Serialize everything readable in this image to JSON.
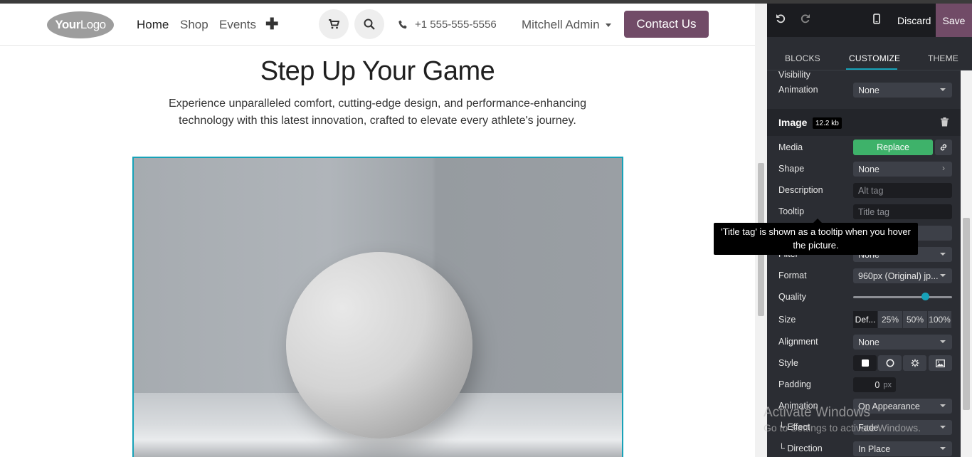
{
  "navbar": {
    "logo": {
      "bold": "Your",
      "thin": "Logo"
    },
    "links": [
      "Home",
      "Shop",
      "Events"
    ],
    "plus": "✚",
    "phone": "+1 555-555-5556",
    "user": "Mitchell Admin",
    "contact_label": "Contact Us"
  },
  "hero": {
    "title": "Step Up Your Game",
    "subtitle": "Experience unparalleled comfort, cutting-edge design, and performance-enhancing technology with this latest innovation, crafted to elevate every athlete's journey."
  },
  "editor": {
    "discard_label": "Discard",
    "save_label": "Save",
    "tabs": [
      "BLOCKS",
      "CUSTOMIZE",
      "THEME"
    ],
    "active_tab": "CUSTOMIZE",
    "visibility_label": "Visibility",
    "animation_top": {
      "label": "Animation",
      "value": "None"
    },
    "image_section": {
      "title": "Image",
      "size_badge": "12.2 kb"
    },
    "media": {
      "label": "Media",
      "replace_label": "Replace"
    },
    "shape": {
      "label": "Shape",
      "value": "None"
    },
    "description": {
      "label": "Description",
      "placeholder": "Alt tag"
    },
    "tooltip_row": {
      "label": "Tooltip",
      "placeholder": "Title tag"
    },
    "filter": {
      "label": "Filter",
      "value": "None"
    },
    "format": {
      "label": "Format",
      "value": "960px (Original) jp..."
    },
    "quality": {
      "label": "Quality",
      "value": 0.73
    },
    "size": {
      "label": "Size",
      "options": [
        "Def...",
        "25%",
        "50%",
        "100%"
      ],
      "selected": "Def..."
    },
    "alignment": {
      "label": "Alignment",
      "value": "None"
    },
    "style": {
      "label": "Style"
    },
    "padding": {
      "label": "Padding",
      "value": "0",
      "unit": "px"
    },
    "animation": {
      "label": "Animation",
      "value": "On Appearance"
    },
    "effect": {
      "label": "└ Effect",
      "value": "Fade"
    },
    "direction": {
      "label": "└ Direction",
      "value": "In Place"
    }
  },
  "tooltip_popup": "'Title tag' is shown as a tooltip when you hover the picture.",
  "watermark": {
    "line1": "Activate Windows",
    "line2": "Go to Settings to activate Windows."
  },
  "colors": {
    "accent": "#714b67",
    "cyan": "#17a2b8",
    "green": "#3eb26a",
    "panel_bg": "#2b2d33"
  }
}
